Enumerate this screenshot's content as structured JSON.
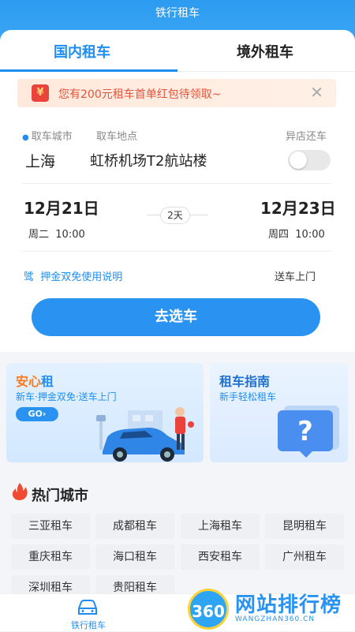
{
  "header": {
    "title": "铁行租车"
  },
  "tabs": {
    "domestic": "国内租车",
    "overseas": "境外租车"
  },
  "promo": {
    "text": "您有200元租车首单红包待领取~",
    "close": "✕",
    "badge": "¥"
  },
  "pickup": {
    "city_label": "取车城市",
    "place_label": "取车地点",
    "diff_return_label": "异店还车",
    "city": "上海",
    "place": "虹桥机场T2航站楼",
    "diff_return_on": false
  },
  "dates": {
    "start_date": "12月21日",
    "start_day": "周二",
    "start_time": "10:00",
    "duration": "2天",
    "end_date": "12月23日",
    "end_day": "周四",
    "end_time": "10:00"
  },
  "options": {
    "deposit_icon": "骘",
    "deposit_text": "押金双免使用说明",
    "delivery_text": "送车上门"
  },
  "go_button": "去选车",
  "banner_left": {
    "title_a": "安心",
    "title_b": "租",
    "subtitle": "新车·押金双免·送车上门",
    "go": "GO›"
  },
  "banner_right": {
    "title": "租车指南",
    "subtitle": "新手轻松租车"
  },
  "hot_cities": {
    "title": "热门城市",
    "items": [
      "三亚租车",
      "成都租车",
      "上海租车",
      "昆明租车",
      "重庆租车",
      "海口租车",
      "西安租车",
      "广州租车",
      "深圳租车",
      "贵阳租车"
    ]
  },
  "bottom_nav": {
    "label": "铁行租车"
  },
  "watermark": {
    "logo": "360",
    "text": "网站排行榜",
    "url": "WANGZHAN360.CN"
  },
  "colors": {
    "accent": "#1f8ef0",
    "header": "#2c9bf0",
    "promo_text": "#e5533c"
  }
}
